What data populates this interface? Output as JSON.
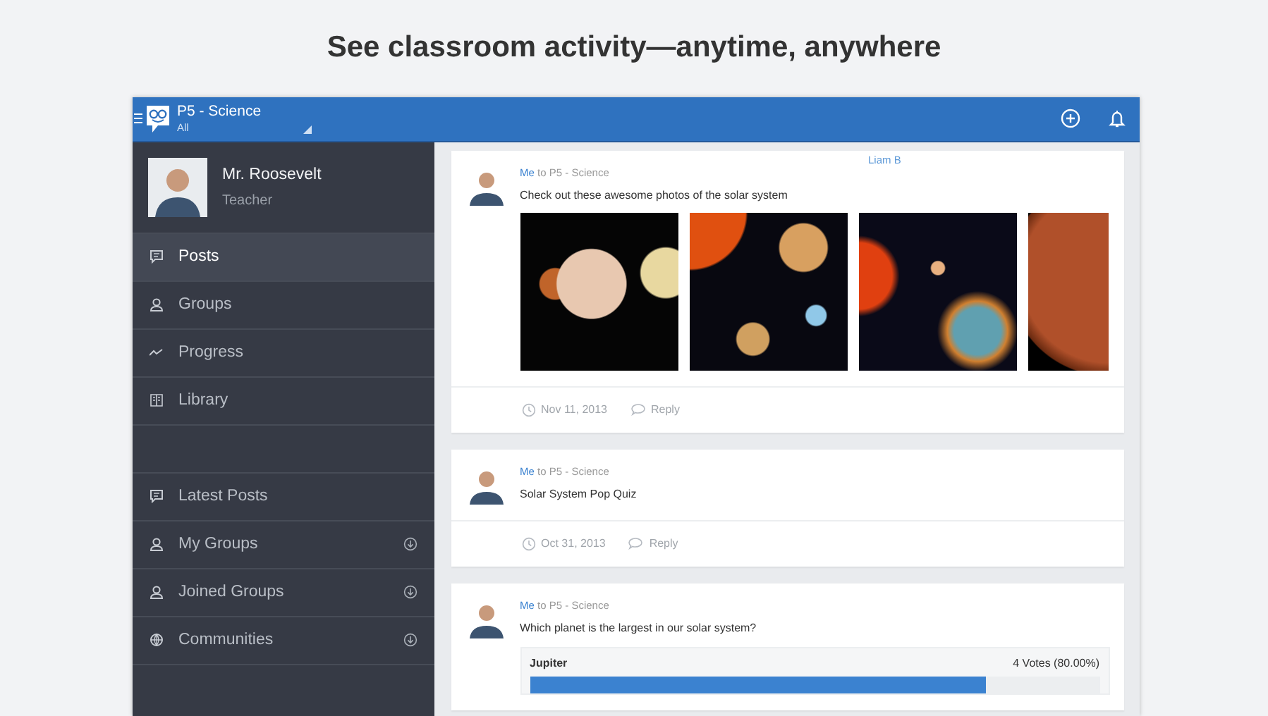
{
  "headline": "See classroom activity—anytime, anywhere",
  "app_bar": {
    "title": "P5 - Science",
    "subtitle": "All"
  },
  "profile": {
    "name": "Mr. Roosevelt",
    "role": "Teacher"
  },
  "sidebar": {
    "items": [
      {
        "label": "Posts",
        "kind": "posts",
        "selected": true
      },
      {
        "label": "Groups",
        "kind": "groups",
        "selected": false
      },
      {
        "label": "Progress",
        "kind": "progress",
        "selected": false
      },
      {
        "label": "Library",
        "kind": "library",
        "selected": false
      }
    ],
    "lower_items": [
      {
        "label": "Latest Posts",
        "kind": "posts",
        "expandable": false
      },
      {
        "label": "My Groups",
        "kind": "groups",
        "expandable": true
      },
      {
        "label": "Joined Groups",
        "kind": "groups",
        "expandable": true
      },
      {
        "label": "Communities",
        "kind": "globe",
        "expandable": true
      }
    ]
  },
  "floating_label": "Liam B",
  "posts": [
    {
      "author": "Me",
      "to": "to P5 - Science",
      "text": "Check out these awesome photos of the solar system",
      "kind": "photos",
      "photos": [
        {
          "kind": "planets-row"
        },
        {
          "kind": "solar-map"
        },
        {
          "kind": "orbits"
        },
        {
          "kind": "close-up"
        }
      ],
      "date": "Nov 11, 2013",
      "reply": "Reply"
    },
    {
      "author": "Me",
      "to": "to P5 - Science",
      "text": "Solar System Pop Quiz",
      "kind": "text",
      "date": "Oct 31, 2013",
      "reply": "Reply"
    },
    {
      "author": "Me",
      "to": "to P5 - Science",
      "text": "Which planet is the largest in our solar system?",
      "kind": "poll",
      "poll": [
        {
          "option": "Jupiter",
          "votes": "4 Votes (80.00%)",
          "level": 0.8
        }
      ]
    }
  ]
}
